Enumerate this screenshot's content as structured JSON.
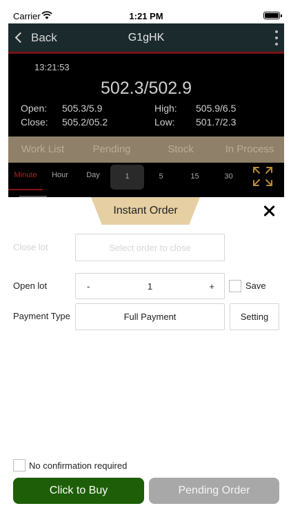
{
  "status_bar": {
    "carrier": "Carrier",
    "time": "1:21 PM"
  },
  "nav": {
    "back_label": "Back",
    "title": "G1gHK"
  },
  "quote": {
    "time": "13:21:53",
    "price": "502.3/502.9",
    "open_label": "Open:",
    "open_value": "505.3/5.9",
    "close_label": "Close:",
    "close_value": "505.2/05.2",
    "high_label": "High:",
    "high_value": "505.9/6.5",
    "low_label": "Low:",
    "low_value": "501.7/2.3"
  },
  "tabs": [
    "Work List",
    "Pending",
    "Stock",
    "In Process"
  ],
  "time_frames": {
    "minute": "Minute",
    "hour": "Hour",
    "day": "Day",
    "m1": "1",
    "m5": "5",
    "m15": "15",
    "m30": "30"
  },
  "order": {
    "title": "Instant Order",
    "close_lot_label": "Close lot",
    "close_lot_placeholder": "Select order to close",
    "open_lot_label": "Open lot",
    "minus": "-",
    "open_lot_value": "1",
    "plus": "+",
    "save_label": "Save",
    "payment_type_label": "Payment Type",
    "payment_type_value": "Full Payment",
    "setting_label": "Setting",
    "no_confirm_label": "No confirmation required",
    "buy_label": "Click to  Buy",
    "pending_label": "Pending Order"
  },
  "colors": {
    "buy": "#1e5e08",
    "pending": "#a8a8a8",
    "accent": "#e6cfa2",
    "tabs": "#8f8069"
  }
}
